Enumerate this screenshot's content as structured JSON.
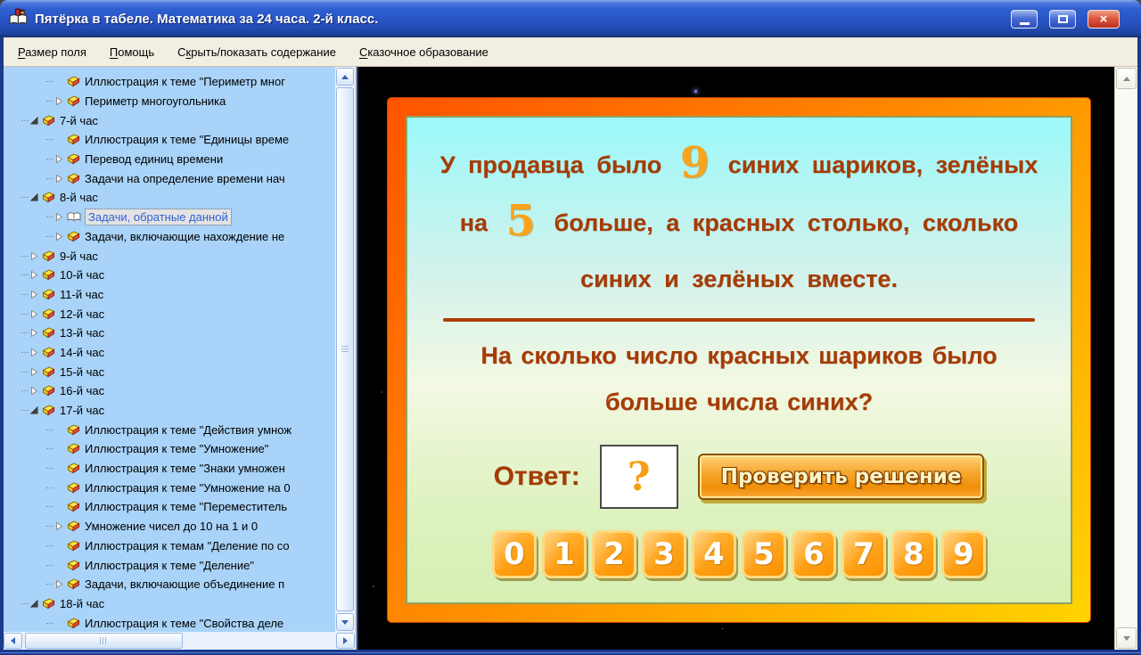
{
  "window": {
    "title": "Пятёрка в табеле. Математика за 24 часа. 2-й класс."
  },
  "icons": {
    "app_icon": "books",
    "minimize_icon": "minimize",
    "maximize_icon": "maximize",
    "close_icon": "close",
    "tree_node_icon": "yellow-book",
    "selected_node_icon": "open-book",
    "expander_collapsed": "triangle-outline-right",
    "expander_expanded": "triangle-filled-down-right"
  },
  "menu": {
    "items": [
      {
        "label": "Размер поля",
        "underline": 0
      },
      {
        "label": "Помощь",
        "underline": 0
      },
      {
        "label": "Скрыть/показать содержание",
        "underline": 1
      },
      {
        "label": "Сказочное образование",
        "underline": 0
      }
    ]
  },
  "tree": {
    "items": [
      {
        "label": "Иллюстрация к теме \"Периметр мног",
        "level": 2,
        "expander": "none",
        "icon": "book"
      },
      {
        "label": "Периметр многоугольника",
        "level": 2,
        "expander": "collapsed",
        "icon": "book"
      },
      {
        "label": "7-й час",
        "level": 1,
        "expander": "expanded",
        "icon": "book"
      },
      {
        "label": "Иллюстрация к теме \"Единицы време",
        "level": 2,
        "expander": "none",
        "icon": "book"
      },
      {
        "label": "Перевод единиц времени",
        "level": 2,
        "expander": "collapsed",
        "icon": "book"
      },
      {
        "label": "Задачи на определение времени нач",
        "level": 2,
        "expander": "collapsed",
        "icon": "book"
      },
      {
        "label": "8-й час",
        "level": 1,
        "expander": "expanded",
        "icon": "book"
      },
      {
        "label": "Задачи, обратные данной",
        "level": 2,
        "expander": "collapsed",
        "icon": "open-book",
        "selected": true
      },
      {
        "label": "Задачи, включающие нахождение не",
        "level": 2,
        "expander": "collapsed",
        "icon": "book"
      },
      {
        "label": "9-й час",
        "level": 1,
        "expander": "collapsed",
        "icon": "book"
      },
      {
        "label": "10-й час",
        "level": 1,
        "expander": "collapsed",
        "icon": "book"
      },
      {
        "label": "11-й час",
        "level": 1,
        "expander": "collapsed",
        "icon": "book"
      },
      {
        "label": "12-й час",
        "level": 1,
        "expander": "collapsed",
        "icon": "book"
      },
      {
        "label": "13-й час",
        "level": 1,
        "expander": "collapsed",
        "icon": "book"
      },
      {
        "label": "14-й час",
        "level": 1,
        "expander": "collapsed",
        "icon": "book"
      },
      {
        "label": "15-й час",
        "level": 1,
        "expander": "collapsed",
        "icon": "book"
      },
      {
        "label": "16-й час",
        "level": 1,
        "expander": "collapsed",
        "icon": "book"
      },
      {
        "label": "17-й час",
        "level": 1,
        "expander": "expanded",
        "icon": "book"
      },
      {
        "label": "Иллюстрация к теме \"Действия умнож",
        "level": 2,
        "expander": "none",
        "icon": "book"
      },
      {
        "label": "Иллюстрация к теме \"Умножение\"",
        "level": 2,
        "expander": "none",
        "icon": "book"
      },
      {
        "label": "Иллюстрация к теме \"Знаки умножен",
        "level": 2,
        "expander": "none",
        "icon": "book"
      },
      {
        "label": "Иллюстрация к теме \"Умножение на 0",
        "level": 2,
        "expander": "none",
        "icon": "book"
      },
      {
        "label": "Иллюстрация к теме \"Переместитель",
        "level": 2,
        "expander": "none",
        "icon": "book"
      },
      {
        "label": "Умножение чисел до 10 на 1 и 0",
        "level": 2,
        "expander": "collapsed",
        "icon": "book"
      },
      {
        "label": "Иллюстрация к темам \"Деление по со",
        "level": 2,
        "expander": "none",
        "icon": "book"
      },
      {
        "label": "Иллюстрация к теме \"Деление\"",
        "level": 2,
        "expander": "none",
        "icon": "book"
      },
      {
        "label": "Задачи, включающие объединение п",
        "level": 2,
        "expander": "collapsed",
        "icon": "book"
      },
      {
        "label": "18-й час",
        "level": 1,
        "expander": "expanded",
        "icon": "book"
      },
      {
        "label": "Иллюстрация к теме \"Свойства деле",
        "level": 2,
        "expander": "none",
        "icon": "book"
      }
    ]
  },
  "problem": {
    "l1a": "У продавца было",
    "l1num": "9",
    "l1b": "синих шариков, зелёных",
    "l2a": "на",
    "l2num": "5",
    "l2b": "больше, а красных столько, сколько",
    "l3": "синих и зелёных вместе.",
    "q1": "На сколько число красных шариков было",
    "q2": "больше числа синих?"
  },
  "answer": {
    "label": "Ответ:",
    "value": "?",
    "check_button": "Проверить решение"
  },
  "keypad": {
    "digits": [
      "0",
      "1",
      "2",
      "3",
      "4",
      "5",
      "6",
      "7",
      "8",
      "9"
    ]
  },
  "colors": {
    "frame_orange": "#FF6A00",
    "frame_yellow": "#FFD400",
    "card_text_brown": "#A63B06",
    "digit_orange": "#F9A41E",
    "tree_bg": "#A9D3F8",
    "titlebar_blue": "#2E5ECF"
  }
}
